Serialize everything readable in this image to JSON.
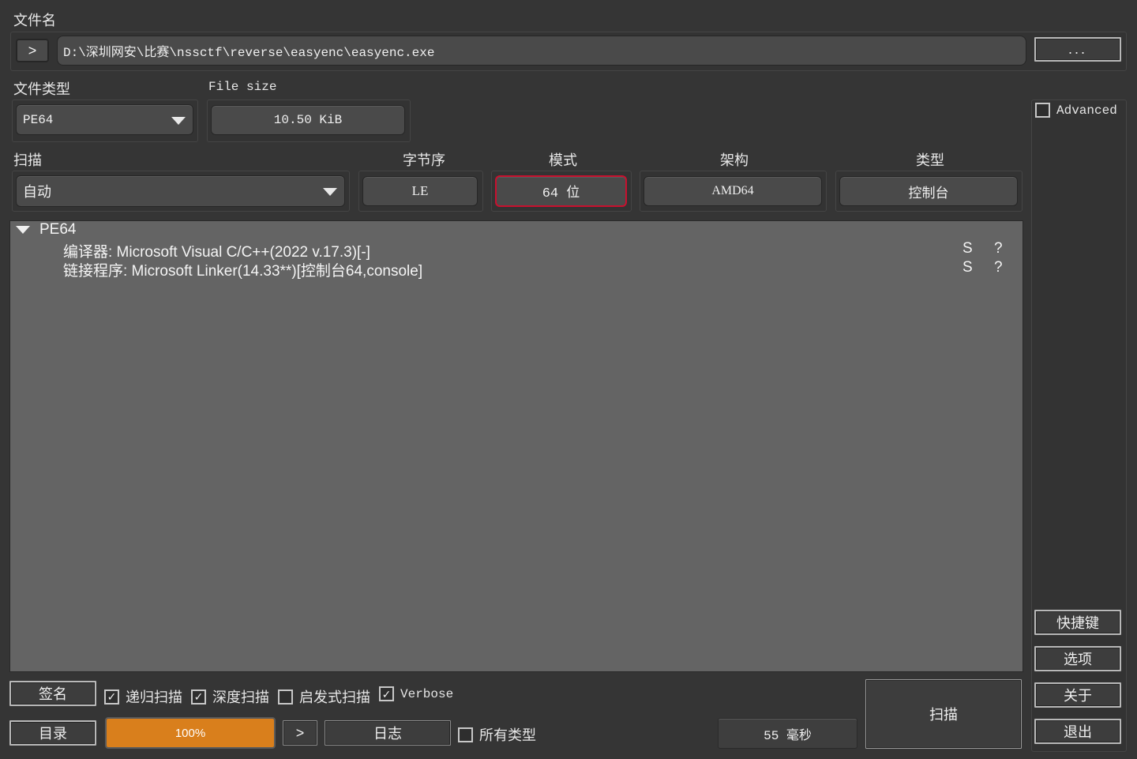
{
  "file": {
    "section_label": "文件名",
    "path": "D:\\深圳网安\\比赛\\nssctf\\reverse\\easyenc\\easyenc.exe",
    "open_button": ">",
    "browse_button": "..."
  },
  "file_type": {
    "label": "文件类型",
    "value": "PE64"
  },
  "file_size": {
    "label": "File size",
    "value": "10.50 KiB"
  },
  "advanced": {
    "label": "Advanced",
    "checked": false
  },
  "scan": {
    "label": "扫描",
    "value": "自动"
  },
  "info": {
    "endianness": {
      "label": "字节序",
      "value": "LE"
    },
    "mode": {
      "label": "模式",
      "value": "64 位",
      "highlight_color": "#c8102e"
    },
    "arch": {
      "label": "架构",
      "value": "AMD64"
    },
    "type": {
      "label": "类型",
      "value": "控制台"
    }
  },
  "results": {
    "root": "PE64",
    "rows": [
      {
        "text": "编译器: Microsoft Visual C/C++(2022 v.17.3)[-]",
        "col1": "S",
        "col2": "?"
      },
      {
        "text": "链接程序: Microsoft Linker(14.33**)[控制台64,console]",
        "col1": "S",
        "col2": "?"
      }
    ]
  },
  "side_buttons": {
    "shortcuts": "快捷键",
    "options": "选项",
    "about": "关于",
    "exit": "退出"
  },
  "bottom": {
    "signature": "签名",
    "directory": "目录",
    "recursive_scan": "递归扫描",
    "recursive_checked": true,
    "deep_scan": "深度扫描",
    "deep_checked": true,
    "heuristic_scan": "启发式扫描",
    "heuristic_checked": false,
    "verbose": "Verbose",
    "verbose_checked": true,
    "progress_text": "100%",
    "progress_value": 1.0,
    "progress_color": "#d97f1c",
    "next_button": ">",
    "log": "日志",
    "all_types": "所有类型",
    "all_types_checked": false,
    "elapsed": "55 毫秒",
    "scan_button": "扫描"
  }
}
